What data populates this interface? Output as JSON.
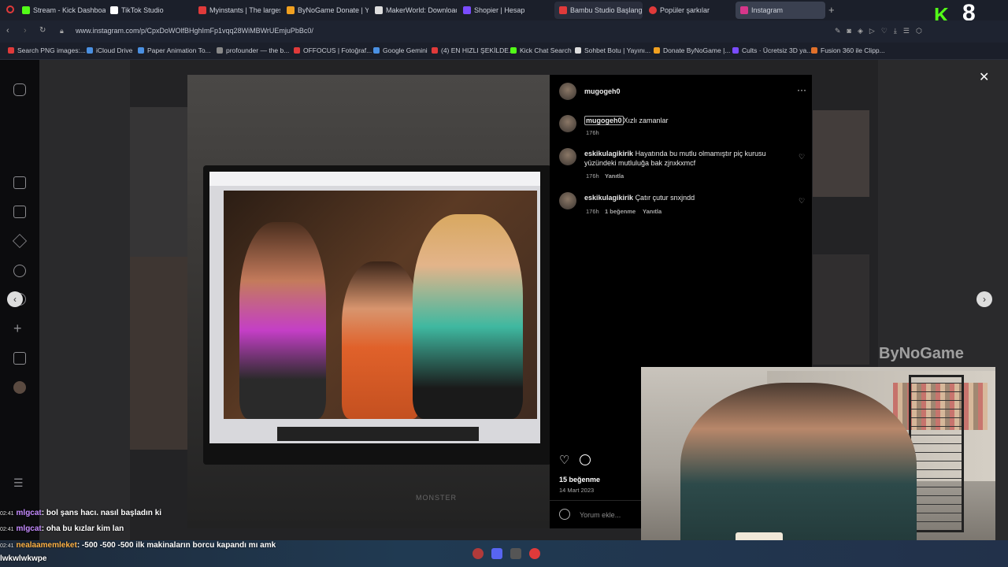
{
  "tabs": [
    {
      "label": "Stream - Kick Dashboard",
      "color": "#53fc18"
    },
    {
      "label": "TikTok Studio",
      "color": "#ffffff"
    },
    {
      "label": "Myinstants | The largest in",
      "color": "#e03a3a"
    },
    {
      "label": "ByNoGame Donate | Yayın",
      "color": "#f0a020"
    },
    {
      "label": "MakerWorld: Download F",
      "color": "#dddddd"
    },
    {
      "label": "Shopier | Hesap",
      "color": "#7a4cff"
    },
    {
      "label": "Bambu Studio Başlangıç E",
      "color": "#e03a3a"
    },
    {
      "label": "Popüler şarkılar",
      "color": "#e03a3a"
    },
    {
      "label": "Instagram",
      "color": "#d6368a"
    }
  ],
  "url": "www.instagram.com/p/CpxDoWOlfBHghImFp1vqq28WiMBWrUEmjuPbBc0/",
  "bookmarks": [
    {
      "label": "Search PNG images:...",
      "color": "#e03a3a"
    },
    {
      "label": "iCloud Drive",
      "color": "#4a90e2"
    },
    {
      "label": "Paper Animation To...",
      "color": "#4a90e2"
    },
    {
      "label": "profounder — the b...",
      "color": "#888888"
    },
    {
      "label": "OFFOCUS | Fotoğraf...",
      "color": "#e03a3a"
    },
    {
      "label": "Google Gemini",
      "color": "#4a90e2"
    },
    {
      "label": "(4) EN HIZLI ŞEKİLDE...",
      "color": "#e03a3a"
    },
    {
      "label": "Kick Chat Search",
      "color": "#53fc18"
    },
    {
      "label": "Sohbet Botu | Yayını...",
      "color": "#dddddd"
    },
    {
      "label": "Donate ByNoGame |...",
      "color": "#f0a020"
    },
    {
      "label": "Cults · Ücretsiz 3D ya...",
      "color": "#7a4cff"
    },
    {
      "label": "Fusion 360 ile Clipp...",
      "color": "#e0702a"
    }
  ],
  "post": {
    "author": "mugogeh0",
    "caption_user": "mugogeh0",
    "caption": "Xızlı zamanlar",
    "caption_time": "176h",
    "comments": [
      {
        "user": "eskikulagikirik",
        "text": "Hayatında bu mutlu olmamıştır piç kurusu yüzündeki mutluluğa bak zjnxkxmcf",
        "time": "176h",
        "likes": "",
        "reply": "Yanıtla"
      },
      {
        "user": "eskikulagikirik",
        "text": "Çatır çutur snxjndd",
        "time": "176h",
        "likes": "1 beğenme",
        "reply": "Yanıtla"
      }
    ],
    "likes": "15 beğenme",
    "date": "14 Mart 2023",
    "comment_placeholder": "Yorum ekle..."
  },
  "monitor_brand": "MONSTER",
  "chat": [
    {
      "time": "02:41",
      "user": "mlgcat",
      "text": ": bol şans hacı. nasıl başladın ki"
    },
    {
      "time": "02:41",
      "user": "mlgcat",
      "text": ": oha bu kızlar kim lan"
    },
    {
      "time": "02:41",
      "user": "nealaamemleket",
      "text": ": -500 -500 -500 ilk makinaların borcu kapandı mı amk"
    },
    {
      "time": "",
      "user": "",
      "text": "lwkwlwkwpe"
    }
  ],
  "watermark": "ByNoGame",
  "kick_logo": "K",
  "kick_number": "8"
}
